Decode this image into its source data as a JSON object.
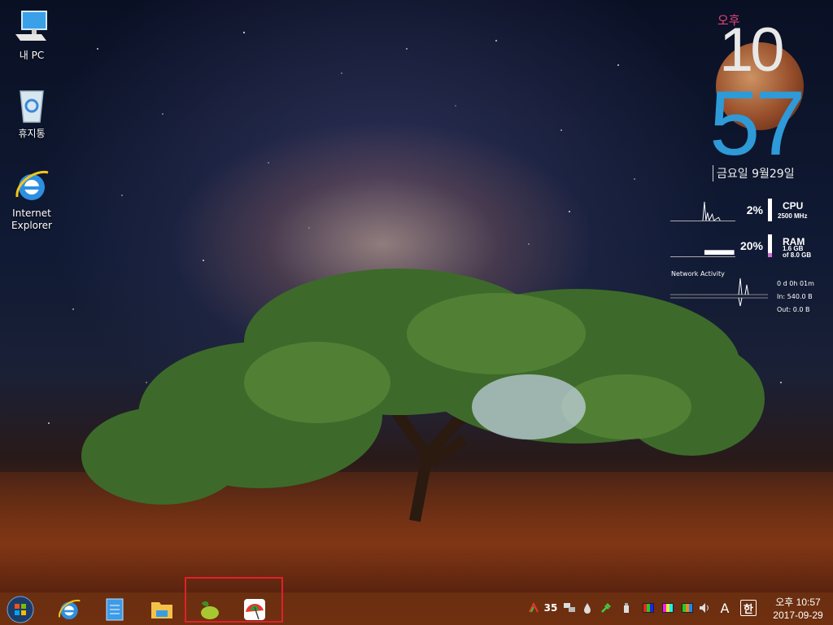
{
  "desktop": {
    "icons": [
      {
        "label": "내 PC",
        "icon": "computer-icon"
      },
      {
        "label": "휴지통",
        "icon": "recycle-bin-icon"
      },
      {
        "label_line1": "Internet",
        "label_line2": "Explorer",
        "icon": "internet-explorer-icon"
      }
    ]
  },
  "clock": {
    "ampm": "오후",
    "hour": "10",
    "minute": "57",
    "date": "금요일 9월29일",
    "colors": {
      "ampm": "#e8467c",
      "minute": "#2e9ad8"
    }
  },
  "monitor": {
    "cpu": {
      "percent": "2%",
      "label": "CPU",
      "sub": "2500 MHz",
      "value": 0.02
    },
    "ram": {
      "percent": "20%",
      "label": "RAM",
      "used": "1.6 GB",
      "total": "of  8.0 GB",
      "value": 0.2
    },
    "network": {
      "title": "Network Activity",
      "uptime": "0 d 0h 01m",
      "in": "In: 540.0 B",
      "out": "Out: 0.0 B"
    }
  },
  "taskbar": {
    "buttons": [
      {
        "icon": "start-orb-icon"
      },
      {
        "icon": "internet-explorer-icon"
      },
      {
        "icon": "notepad-icon"
      },
      {
        "icon": "file-explorer-icon"
      },
      {
        "icon": "lime-app-icon"
      },
      {
        "icon": "beach-umbrella-app-icon"
      }
    ],
    "tray": {
      "badge_number": "35",
      "ime_letter": "A",
      "ime_hangul": "한",
      "time": "오후 10:57",
      "date": "2017-09-29"
    },
    "highlight_color": "#e0202a"
  }
}
